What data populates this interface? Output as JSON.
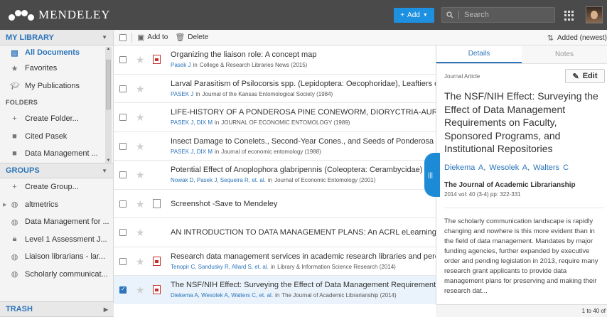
{
  "app": {
    "name": "MENDELEY",
    "add_label": "Add",
    "search_placeholder": "Search"
  },
  "sidebar": {
    "my_library": "MY LIBRARY",
    "library_items": [
      {
        "label": "All Documents",
        "icon": "documents-icon"
      },
      {
        "label": "Favorites",
        "icon": "star-icon"
      },
      {
        "label": "My Publications",
        "icon": "graduation-cap-icon"
      }
    ],
    "folders_label": "FOLDERS",
    "folder_items": [
      {
        "label": "Create Folder...",
        "icon": "plus-icon"
      },
      {
        "label": "Cited Pasek",
        "icon": "folder-icon"
      },
      {
        "label": "Data Management ...",
        "icon": "folder-icon"
      }
    ],
    "groups": "GROUPS",
    "group_items": [
      {
        "label": "Create Group...",
        "icon": "plus-icon"
      },
      {
        "label": "altmetrics",
        "icon": "globe-icon"
      },
      {
        "label": "Data Management for ...",
        "icon": "globe-icon"
      },
      {
        "label": "Level 1 Assessment J...",
        "icon": "lock-icon"
      },
      {
        "label": "Liaison librarians - lar...",
        "icon": "globe-icon"
      },
      {
        "label": "Scholarly communicat...",
        "icon": "globe-icon"
      }
    ],
    "trash": "TRASH"
  },
  "toolbar": {
    "add_to": "Add to",
    "delete": "Delete",
    "sort": "Added (newest)"
  },
  "documents": [
    {
      "title": "Organizing the liaison role: A concept map",
      "authors": "Pasek J",
      "in": "in",
      "journal": "College & Research Libraries News (2015)",
      "type": "pdf",
      "checked": false
    },
    {
      "title": "Larval Parasitism of Psilocorsis spp. (Lepidoptera: Oecophoridae), Leaftiers o",
      "authors": "PASEK J",
      "in": "in",
      "journal": "Journal of the Kansas Entomological Society (1984)",
      "type": "none",
      "checked": false
    },
    {
      "title": "LIFE-HISTORY OF A PONDEROSA PINE CONEWORM, DIORYCTRIA-AURANT",
      "authors": "PASEK J, DIX M",
      "in": "in",
      "journal": "JOURNAL OF ECONOMIC ENTOMOLOGY (1989)",
      "type": "none",
      "checked": false
    },
    {
      "title": "Insect Damage to Conelets., Second-Year Cones., and Seeds of Ponderosa F",
      "authors": "PASEK J, DIX M",
      "in": "in",
      "journal": "Journal of economic entomology (1988)",
      "type": "none",
      "checked": false
    },
    {
      "title": "Potential Effect of Anoplophora glabripennis (Coleoptera: Cerambycidae) o",
      "authors": "Nowak D, Pasek J, Sequeira R, et. al.",
      "in": "in",
      "journal": "Journal of Economic Entomology (2001)",
      "type": "none",
      "checked": false
    },
    {
      "title": "Screenshot -Save to Mendeley",
      "authors": "",
      "in": "",
      "journal": "",
      "type": "file",
      "checked": false
    },
    {
      "title": "AN INTRODUCTION TO DATA MANAGEMENT PLANS: An ACRL eLearning W",
      "authors": "",
      "in": "",
      "journal": "",
      "type": "none",
      "checked": false
    },
    {
      "title": "Research data management services in academic research libraries and perc",
      "authors": "Tenopir C, Sandusky R, Allard S, et. al.",
      "in": "in",
      "journal": "Library & Information Science Research (2014)",
      "type": "pdf",
      "checked": false
    },
    {
      "title": "The NSF/NIH Effect: Surveying the Effect of Data Management Requirements",
      "authors": "Diekema A, Wesolek A, Walters C, et. al.",
      "in": "in",
      "journal": "The Journal of Academic Librarianship (2014)",
      "type": "pdf",
      "checked": true
    }
  ],
  "details": {
    "tab_details": "Details",
    "tab_notes": "Notes",
    "doc_type": "Journal Article",
    "edit": "Edit",
    "title": "The NSF/NIH Effect: Surveying the Effect of Data Management Requirements on Faculty, Sponsored Programs, and Institutional Repositories",
    "authors": "Diekema A,  Wesolek A,  Walters C",
    "journal": "The Journal of Academic Librarianship",
    "volume": "2014 vol: 40 (3-4) pp: 322-331",
    "abstract": "The scholarly communication landscape is rapidly changing and nowhere is this more evident than in the field of data management. Mandates by major funding agencies, further expanded by executive order and pending legislation in 2013, require many research grant applicants to provide data management plans for preserving and making their research dat...",
    "paging": "1 to 40 of"
  },
  "colors": {
    "accent": "#2b74b9",
    "topbar": "#4a4a4a",
    "add_button": "#1d90e0",
    "pdf": "#c9302c"
  }
}
